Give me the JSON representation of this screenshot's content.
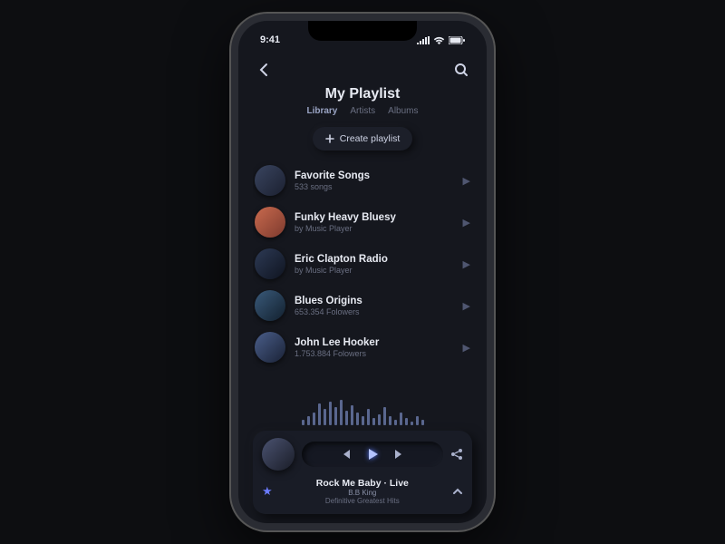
{
  "statusbar": {
    "time": "9:41"
  },
  "header": {
    "title": "My Playlist"
  },
  "tabs": [
    {
      "label": "Library",
      "active": true
    },
    {
      "label": "Artists",
      "active": false
    },
    {
      "label": "Albums",
      "active": false
    }
  ],
  "create_button": {
    "label": "Create playlist"
  },
  "playlists": [
    {
      "title": "Favorite Songs",
      "sub": "533 songs"
    },
    {
      "title": "Funky Heavy Bluesy",
      "sub": "by Music Player"
    },
    {
      "title": "Eric Clapton Radio",
      "sub": "by Music Player"
    },
    {
      "title": "Blues Origins",
      "sub": "653.354 Folowers"
    },
    {
      "title": "John Lee Hooker",
      "sub": "1.753.884 Folowers"
    }
  ],
  "now_playing": {
    "title": "Rock Me Baby · Live",
    "artist": "B.B King",
    "album": "Definitive Greatest Hits"
  }
}
